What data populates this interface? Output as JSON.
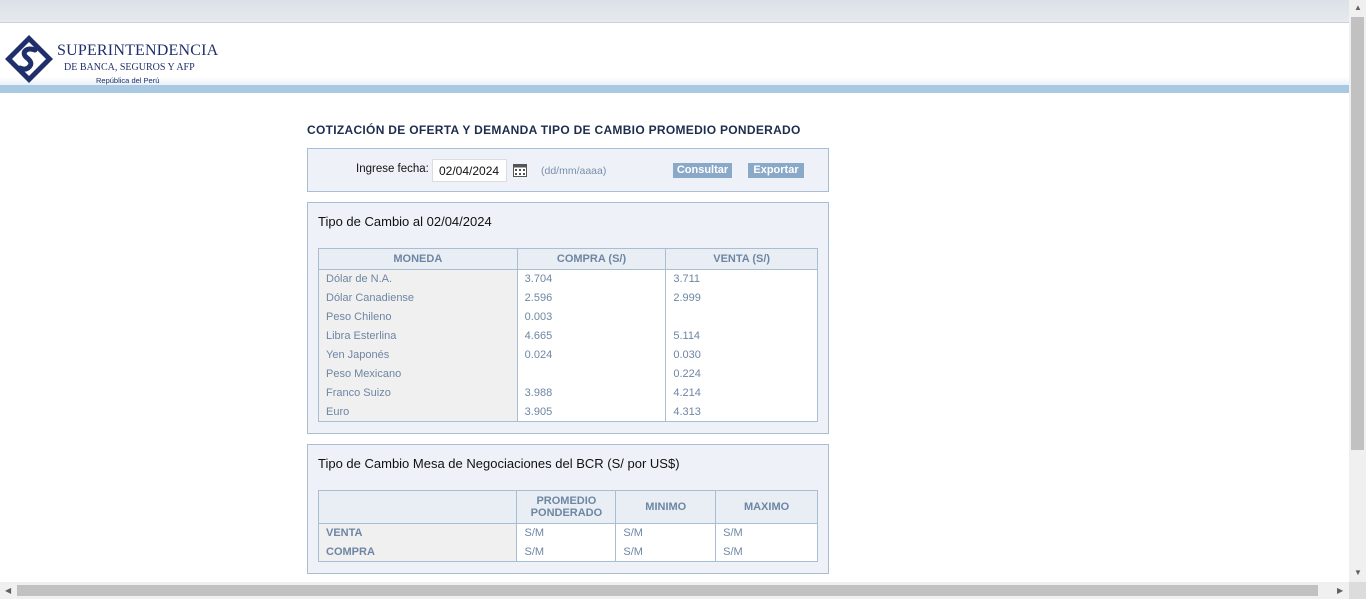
{
  "header": {
    "logo_title": "SUPERINTENDENCIA",
    "logo_subtitle": "DE BANCA, SEGUROS Y AFP",
    "logo_country": "República del Perú"
  },
  "page_title": "COTIZACIÓN DE OFERTA Y DEMANDA TIPO DE CAMBIO PROMEDIO PONDERADO",
  "search": {
    "label": "Ingrese fecha:",
    "date_value": "02/04/2024",
    "format_hint": "(dd/mm/aaaa)",
    "consultar_label": "Consultar",
    "exportar_label": "Exportar"
  },
  "rates": {
    "title": "Tipo de Cambio al 02/04/2024",
    "headers": [
      "MONEDA",
      "COMPRA (S/)",
      "VENTA (S/)"
    ],
    "rows": [
      [
        "Dólar de N.A.",
        "3.704",
        "3.711"
      ],
      [
        "Dólar Canadiense",
        "2.596",
        "2.999"
      ],
      [
        "Peso Chileno",
        "0.003",
        ""
      ],
      [
        "Libra Esterlina",
        "4.665",
        "5.114"
      ],
      [
        "Yen Japonés",
        "0.024",
        "0.030"
      ],
      [
        "Peso Mexicano",
        "",
        "0.224"
      ],
      [
        "Franco Suizo",
        "3.988",
        "4.214"
      ],
      [
        "Euro",
        "3.905",
        "4.313"
      ]
    ]
  },
  "bcr": {
    "title": "Tipo de Cambio Mesa de Negociaciones del BCR (S/ por US$)",
    "headers": [
      "",
      "PROMEDIO PONDERADO",
      "MINIMO",
      "MAXIMO"
    ],
    "rows": [
      [
        "VENTA",
        "S/M",
        "S/M",
        "S/M"
      ],
      [
        "COMPRA",
        "S/M",
        "S/M",
        "S/M"
      ]
    ]
  },
  "icons": {
    "calendar": "calendar-icon",
    "logo": "sbs-logo-icon"
  }
}
